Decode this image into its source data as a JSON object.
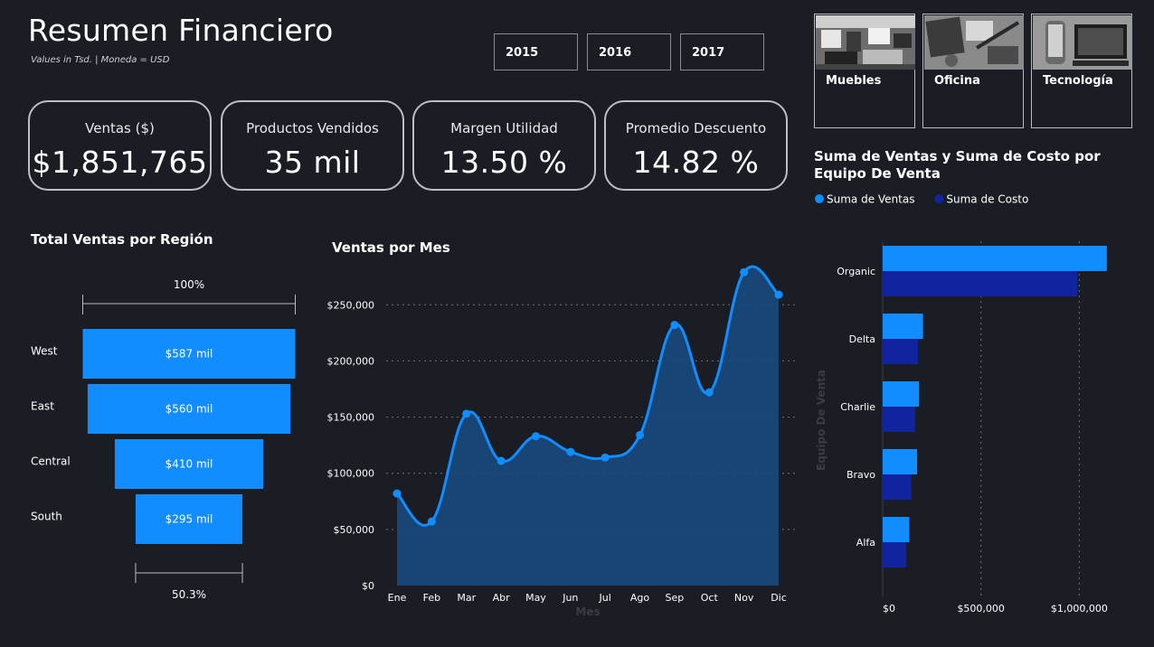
{
  "header": {
    "title": "Resumen Financiero",
    "subtitle": "Values in Tsd.  |  Moneda = USD"
  },
  "years": [
    "2015",
    "2016",
    "2017"
  ],
  "categories": [
    {
      "label": "Muebles",
      "icon": "furniture-photo"
    },
    {
      "label": "Oficina",
      "icon": "office-supplies-photo"
    },
    {
      "label": "Tecnología",
      "icon": "technology-photo"
    }
  ],
  "kpis": [
    {
      "label": "Ventas ($)",
      "value": "$1,851,765"
    },
    {
      "label": "Productos Vendidos",
      "value": "35 mil"
    },
    {
      "label": "Margen Utilidad",
      "value": "13.50 %"
    },
    {
      "label": "Promedio Descuento",
      "value": "14.82 %"
    }
  ],
  "colors": {
    "background": "#1b1d24",
    "accent": "#118dff",
    "dark_blue": "#12239e",
    "area_fill": "#1a4a7e",
    "border": "#bdbfc4"
  },
  "chart_data": [
    {
      "type": "funnel",
      "title": "Total Ventas por Región",
      "categories": [
        "West",
        "East",
        "Central",
        "South"
      ],
      "values": [
        587,
        560,
        410,
        295
      ],
      "value_labels": [
        "$587 mil",
        "$560 mil",
        "$410 mil",
        "$295 mil"
      ],
      "top_label": "100%",
      "bottom_label": "50.3%"
    },
    {
      "type": "area",
      "title": "Ventas por Mes",
      "xlabel": "Mes",
      "categories": [
        "Ene",
        "Feb",
        "Mar",
        "Abr",
        "May",
        "Jun",
        "Jul",
        "Ago",
        "Sep",
        "Oct",
        "Nov",
        "Dic"
      ],
      "values": [
        82000,
        57000,
        153000,
        111000,
        133000,
        119000,
        114000,
        134000,
        232000,
        172000,
        279000,
        259000
      ],
      "yticks": [
        "$0",
        "$50,000",
        "$100,000",
        "$150,000",
        "$200,000",
        "$250,000"
      ],
      "ylim": [
        0,
        280000
      ],
      "grid": true
    },
    {
      "type": "bar",
      "orientation": "horizontal",
      "title": "Suma de Ventas y Suma de Costo por Equipo De Venta",
      "ylabel": "Equipo De Venta",
      "categories": [
        "Organic",
        "Delta",
        "Charlie",
        "Bravo",
        "Alfa"
      ],
      "series": [
        {
          "name": "Suma de Ventas",
          "values": [
            1140000,
            205000,
            185000,
            175000,
            135000
          ]
        },
        {
          "name": "Suma de Costo",
          "values": [
            990000,
            180000,
            165000,
            145000,
            120000
          ]
        }
      ],
      "xticks": [
        "$0",
        "$500,000",
        "$1,000,000"
      ],
      "xlim": [
        0,
        1150000
      ],
      "legend": "top-left",
      "grid": true
    }
  ]
}
